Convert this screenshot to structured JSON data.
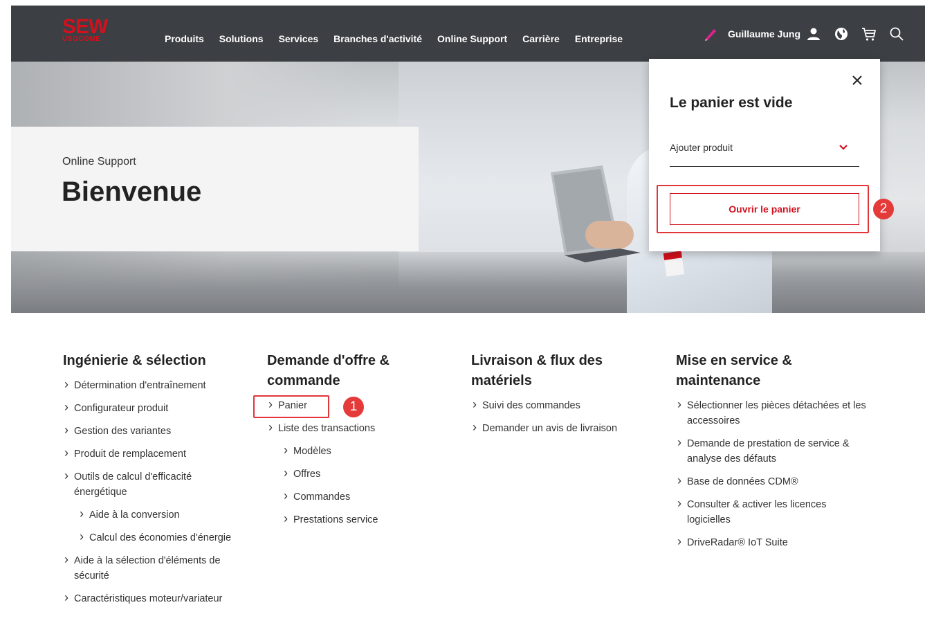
{
  "brand": {
    "logo_top": "SEW",
    "logo_bottom": "USOCOME"
  },
  "nav": [
    "Produits",
    "Solutions",
    "Services",
    "Branches d'activité",
    "Online Support",
    "Carrière",
    "Entreprise"
  ],
  "user": {
    "name": "Guillaume Jung"
  },
  "hero": {
    "subtitle": "Online Support",
    "title": "Bienvenue"
  },
  "cart": {
    "title": "Le panier est vide",
    "select_label": "Ajouter produit",
    "open_button": "Ouvrir le panier"
  },
  "markers": [
    "1",
    "2"
  ],
  "columns": [
    {
      "title": "Ingénierie & sélection",
      "links": [
        {
          "label": "Détermination d'entraînement",
          "level": 0
        },
        {
          "label": "Configurateur produit",
          "level": 0
        },
        {
          "label": "Gestion des variantes",
          "level": 0
        },
        {
          "label": "Produit de remplacement",
          "level": 0
        },
        {
          "label": "Outils de calcul d'efficacité énergétique",
          "level": 0
        },
        {
          "label": "Aide à la conversion",
          "level": 1
        },
        {
          "label": "Calcul des économies d'énergie",
          "level": 1
        },
        {
          "label": "Aide à la sélection d'éléments de sécurité",
          "level": 0
        },
        {
          "label": "Caractéristiques moteur/variateur",
          "level": 0
        }
      ]
    },
    {
      "title": "Demande d'offre & commande",
      "links": [
        {
          "label": "Panier",
          "level": 0
        },
        {
          "label": "Liste des transactions",
          "level": 0
        },
        {
          "label": "Modèles",
          "level": 1
        },
        {
          "label": "Offres",
          "level": 1
        },
        {
          "label": "Commandes",
          "level": 1
        },
        {
          "label": "Prestations service",
          "level": 1
        }
      ]
    },
    {
      "title": "Livraison & flux des matériels",
      "links": [
        {
          "label": "Suivi des commandes",
          "level": 0
        },
        {
          "label": "Demander un avis de livraison",
          "level": 0
        }
      ]
    },
    {
      "title": "Mise en service & maintenance",
      "links": [
        {
          "label": "Sélectionner les pièces détachées et les accessoires",
          "level": 0
        },
        {
          "label": "Demande de prestation de service & analyse des défauts",
          "level": 0
        },
        {
          "label": "Base de données CDM®",
          "level": 0
        },
        {
          "label": "Consulter & activer les licences logicielles",
          "level": 0
        },
        {
          "label": "DriveRadar® IoT Suite",
          "level": 0
        }
      ]
    }
  ],
  "colors": {
    "brand_red": "#d3101d",
    "header_bg": "#3c3f43",
    "marker_red": "#e53a3a"
  }
}
